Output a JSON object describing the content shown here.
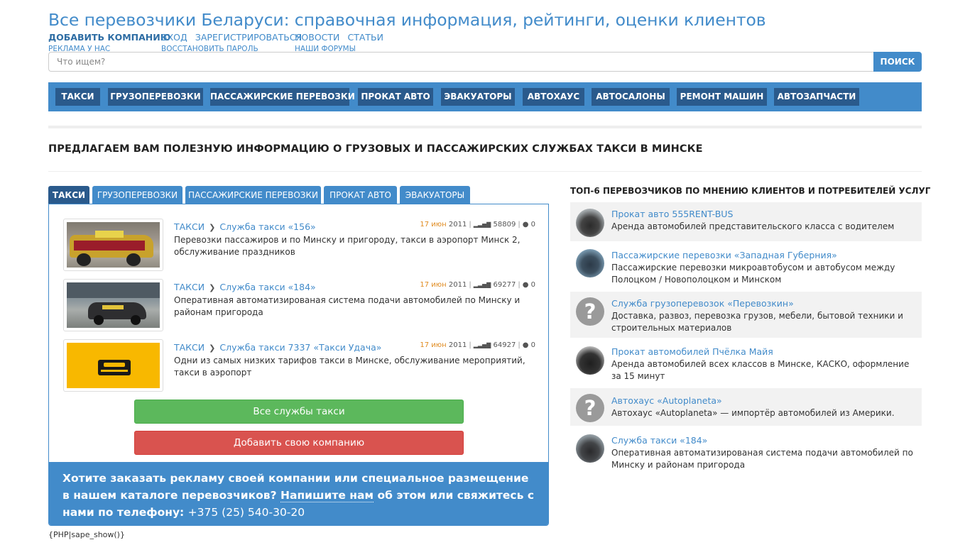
{
  "site": {
    "title": "Все перевозчики Беларуси: справочная информация, рейтинги, оценки клиентов"
  },
  "toplinks": {
    "add_company": "ДОБАВИТЬ КОМПАНИЮ",
    "advertising": "РЕКЛАМА У НАС",
    "login": "ВХОД",
    "restore_password": "ВОССТАНОВИТЬ ПАРОЛЬ",
    "register": "ЗАРЕГИСТРИРОВАТЬСЯ",
    "news": "НОВОСТИ",
    "forums": "НАШИ ФОРУМЫ",
    "articles": "СТАТЬИ"
  },
  "search": {
    "placeholder": "Что ищем?",
    "button": "ПОИСК"
  },
  "mainnav": [
    "ТАКСИ",
    "ГРУЗОПЕРЕВОЗКИ",
    "ПАССАЖИРСКИЕ ПЕРЕВОЗКИ",
    "ПРОКАТ АВТО",
    "ЭВАКУАТОРЫ",
    "АВТОХАУС",
    "АВТОСАЛОНЫ",
    "РЕМОНТ МАШИН",
    "АВТОЗАПЧАСТИ"
  ],
  "heading": "ПРЕДЛАГАЕМ ВАМ ПОЛЕЗНУЮ ИНФОРМАЦИЮ О ГРУЗОВЫХ И ПАССАЖИРСКИХ СЛУЖБАХ ТАКСИ В МИНСКЕ",
  "tabs": [
    "ТАКСИ",
    "ГРУЗОПЕРЕВОЗКИ",
    "ПАССАЖИРСКИЕ ПЕРЕВОЗКИ",
    "ПРОКАТ АВТО",
    "ЭВАКУАТОРЫ"
  ],
  "entries": [
    {
      "category": "ТАКСИ",
      "name": "Служба такси «156»",
      "date": "17 июн",
      "year": "2011",
      "views": "58809",
      "comments": "0",
      "desc": "Перевозки пассажиров и по Минску и пригороду, такси в аэропорт Минск 2, обслуживание праздников"
    },
    {
      "category": "ТАКСИ",
      "name": "Служба такси «184»",
      "date": "17 июн",
      "year": "2011",
      "views": "69277",
      "comments": "0",
      "desc": "Оперативная автоматизированая система подачи автомобилей по Минску и районам пригорода"
    },
    {
      "category": "ТАКСИ",
      "name": "Служба такси 7337 «Такси Удача»",
      "date": "17 июн",
      "year": "2011",
      "views": "64927",
      "comments": "0",
      "desc": "Одни из самых низких тарифов такси в Минске, обслуживание мероприятий, такси в аэропорт"
    }
  ],
  "buttons": {
    "all_taxi": "Все службы такси",
    "add_company": "Добавить свою компанию"
  },
  "promo": {
    "text1": "Хотите заказать рекламу своей компании или специальное размещение в нашем каталоге перевозчиков? ",
    "link": "Напишите нам",
    "text2": " об этом или свяжитесь с нами по телефону: ",
    "phone": "+375 (25) 540-30-20"
  },
  "php_note": "{PHP|sape_show()}",
  "sidebar": {
    "title": "ТОП-6 ПЕРЕВОЗЧИКОВ ПО МНЕНИЮ КЛИЕНТОВ И ПОТРЕБИТЕЛЕЙ УСЛУГ",
    "items": [
      {
        "name": "Прокат авто 555RENT-BUS",
        "desc": "Аренда автомобилей представительского класса с водителем"
      },
      {
        "name": "Пассажирские перевозки «Западная Губерния»",
        "desc": "Пассажирские перевозки микроавтобусом и автобусом между Полоцком / Новополоцком и Минском"
      },
      {
        "name": "Служба грузоперевозок «Перевозкин»",
        "desc": "Доставка, развоз, перевозка грузов, мебели, бытовой техники и строительных материалов"
      },
      {
        "name": "Прокат автомобилей Пчёлка Майя",
        "desc": "Аренда автомобилей всех классов в Минске, КАСКО, оформление за 15 минут"
      },
      {
        "name": "Автохаус «Autoplaneta»",
        "desc": "Автохаус «Autoplaneta» — импортёр автомобилей из Америки."
      },
      {
        "name": "Служба такси «184»",
        "desc": "Оперативная автоматизированая система подачи автомобилей по Минску и районам пригорода"
      }
    ]
  },
  "colors": {
    "brand": "#428bca",
    "dark": "#2a5a8c",
    "green": "#5cb85c",
    "red": "#d9534f",
    "date": "#e08a1e"
  }
}
